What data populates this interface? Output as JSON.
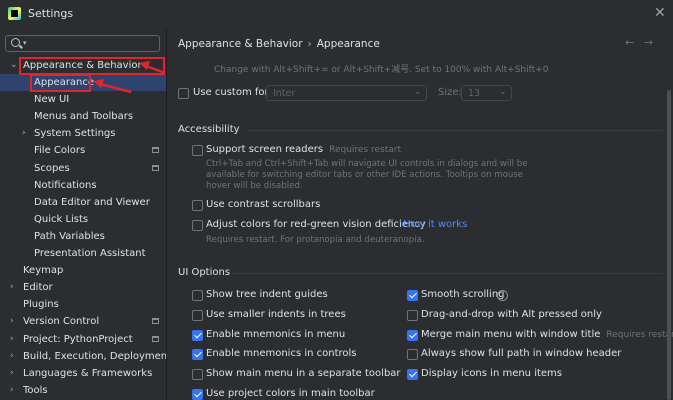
{
  "window": {
    "title": "Settings"
  },
  "sidebar": {
    "items": [
      {
        "label": "Appearance & Behavior",
        "level": 0,
        "expanded": true,
        "bold": true
      },
      {
        "label": "Appearance",
        "level": 1,
        "selected": true
      },
      {
        "label": "New UI",
        "level": 1
      },
      {
        "label": "Menus and Toolbars",
        "level": 1
      },
      {
        "label": "System Settings",
        "level": 1,
        "collapsed": true
      },
      {
        "label": "File Colors",
        "level": 1,
        "badge": true
      },
      {
        "label": "Scopes",
        "level": 1,
        "badge": true
      },
      {
        "label": "Notifications",
        "level": 1
      },
      {
        "label": "Data Editor and Viewer",
        "level": 1
      },
      {
        "label": "Quick Lists",
        "level": 1
      },
      {
        "label": "Path Variables",
        "level": 1
      },
      {
        "label": "Presentation Assistant",
        "level": 1
      },
      {
        "label": "Keymap",
        "level": 0,
        "bold": true
      },
      {
        "label": "Editor",
        "level": 0,
        "bold": true,
        "collapsed": true
      },
      {
        "label": "Plugins",
        "level": 0,
        "bold": true
      },
      {
        "label": "Version Control",
        "level": 0,
        "bold": true,
        "collapsed": true,
        "badge": true
      },
      {
        "label": "Project: PythonProject",
        "level": 0,
        "bold": true,
        "collapsed": true,
        "badge": true
      },
      {
        "label": "Build, Execution, Deployment",
        "level": 0,
        "bold": true,
        "collapsed": true
      },
      {
        "label": "Languages & Frameworks",
        "level": 0,
        "bold": true,
        "collapsed": true
      },
      {
        "label": "Tools",
        "level": 0,
        "bold": true,
        "collapsed": true
      }
    ]
  },
  "breadcrumb": {
    "parent": "Appearance & Behavior",
    "current": "Appearance"
  },
  "zoom_hint": "Change with Alt+Shift+= or Alt+Shift+减号. Set to 100% with Alt+Shift+0",
  "font": {
    "label": "Use custom font:",
    "checked": false,
    "font_value": "Inter",
    "size_label": "Size:",
    "size_value": "13"
  },
  "accessibility": {
    "title": "Accessibility",
    "screen_readers": {
      "label": "Support screen readers",
      "note": "Requires restart",
      "checked": false,
      "description": "Ctrl+Tab and Ctrl+Shift+Tab will navigate UI controls in dialogs and will be available for switching editor tabs or other IDE actions. Tooltips on mouse hover will be disabled."
    },
    "contrast_scrollbars": {
      "label": "Use contrast scrollbars",
      "checked": false
    },
    "red_green": {
      "label": "Adjust colors for red-green vision deficiency",
      "link": "How it works",
      "checked": false,
      "description": "Requires restart. For protanopia and deuteranopia."
    }
  },
  "ui_options": {
    "title": "UI Options",
    "left": [
      {
        "label": "Show tree indent guides",
        "checked": false
      },
      {
        "label": "Use smaller indents in trees",
        "checked": false
      },
      {
        "label": "Enable mnemonics in menu",
        "checked": true
      },
      {
        "label": "Enable mnemonics in controls",
        "checked": true
      },
      {
        "label": "Show main menu in a separate toolbar",
        "checked": false
      },
      {
        "label": "Use project colors in main toolbar",
        "checked": true
      }
    ],
    "right": [
      {
        "label": "Smooth scrolling",
        "checked": true,
        "help": "?"
      },
      {
        "label": "Drag-and-drop with Alt pressed only",
        "checked": false
      },
      {
        "label": "Merge main menu with window title",
        "checked": true,
        "note": "Requires restart"
      },
      {
        "label": "Always show full path in window header",
        "checked": false
      },
      {
        "label": "Display icons in menu items",
        "checked": true
      }
    ]
  },
  "colors": {
    "accent": "#3574f0",
    "selection": "#2e436e",
    "annotation": "#e0252e",
    "link": "#548af7"
  }
}
